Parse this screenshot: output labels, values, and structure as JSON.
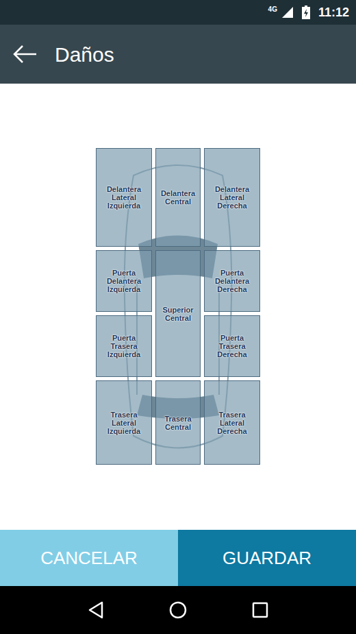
{
  "status_bar": {
    "network": "4G",
    "time": "11:12"
  },
  "toolbar": {
    "title": "Daños"
  },
  "zones": [
    {
      "label": "Delantera Lateral Izquierda"
    },
    {
      "label": "Delantera Central"
    },
    {
      "label": "Delantera Lateral Derecha"
    },
    {
      "label": "Puerta Delantera Izquierda"
    },
    {
      "label": "Superior Central"
    },
    {
      "label": "Puerta Delantera Derecha"
    },
    {
      "label": "Puerta Trasera Izquierda"
    },
    {
      "label": "Puerta Trasera Derecha"
    },
    {
      "label": "Trasera Lateral Izquierda"
    },
    {
      "label": "Trasera Central"
    },
    {
      "label": "Trasera Lateral Derecha"
    }
  ],
  "buttons": [
    "CANCELAR",
    "GUARDAR"
  ]
}
